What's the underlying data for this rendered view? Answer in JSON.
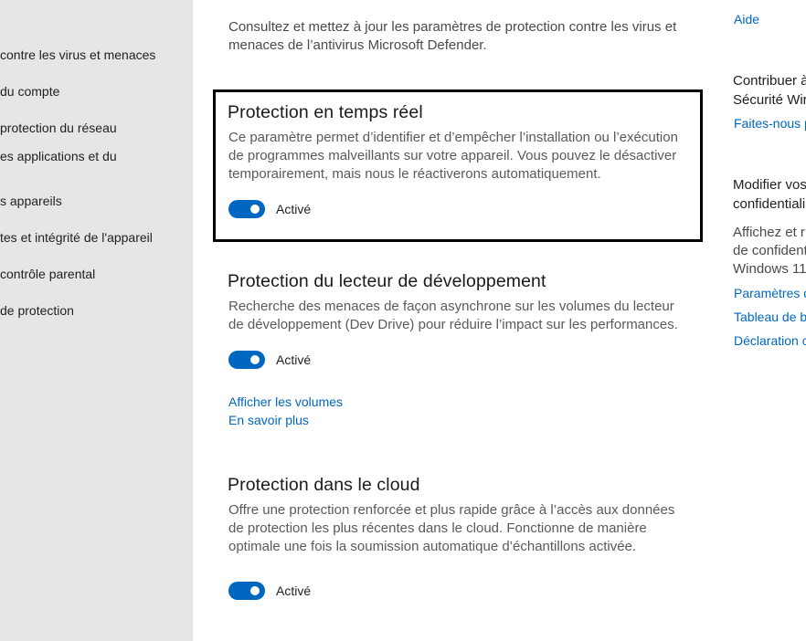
{
  "sidebar": {
    "items": [
      {
        "label": "contre les virus et menaces"
      },
      {
        "label": "du compte"
      },
      {
        "label": " protection du réseau"
      },
      {
        "label": "es applications et du"
      },
      {
        "label": "s appareils"
      },
      {
        "label": "tes et intégrité de l'appareil"
      },
      {
        "label": " contrôle parental"
      },
      {
        "label": "de protection"
      }
    ]
  },
  "intro": {
    "text": "Consultez et mettez à jour les paramètres de protection contre les virus et menaces de l’antivirus Microsoft Defender."
  },
  "sections": [
    {
      "title": "Protection en temps réel",
      "description": "Ce paramètre permet d’identifier et d’empêcher l’installation ou l’exécution de programmes malveillants sur votre appareil. Vous pouvez le désactiver temporairement, mais nous le réactiverons automatiquement.",
      "toggle_label": "Activé",
      "toggle_on": true
    },
    {
      "title": "Protection du lecteur de développement",
      "description": "Recherche des menaces de façon asynchrone sur les volumes du lecteur de développement (Dev Drive) pour réduire l’impact sur les performances.",
      "toggle_label": "Activé",
      "toggle_on": true,
      "links": [
        "Afficher les volumes",
        "En savoir plus"
      ]
    },
    {
      "title": "Protection dans le cloud",
      "description": "Offre une protection renforcée et plus rapide grâce à l’accès aux données de protection les plus récentes dans le cloud. Fonctionne de manière optimale une fois la soumission automatique d’échantillons activée.",
      "toggle_label": "Activé",
      "toggle_on": true
    }
  ],
  "right_panel": {
    "help_link": "Aide",
    "contribute_title_1": "Contribuer à",
    "contribute_title_2": "Sécurité Wir",
    "feedback_link": "Faites-nous p",
    "privacy_title_1": "Modifier vos",
    "privacy_title_2": "confidentiali",
    "privacy_text_1": "Affichez et r",
    "privacy_text_2": "de confident",
    "privacy_text_3": "Windows 11",
    "privacy_links": [
      "Paramètres d",
      "Tableau de b",
      "Déclaration c"
    ]
  },
  "colors": {
    "accent": "#0067c0",
    "sidebar_bg": "#e6e6e6",
    "highlight_border": "#000000"
  }
}
